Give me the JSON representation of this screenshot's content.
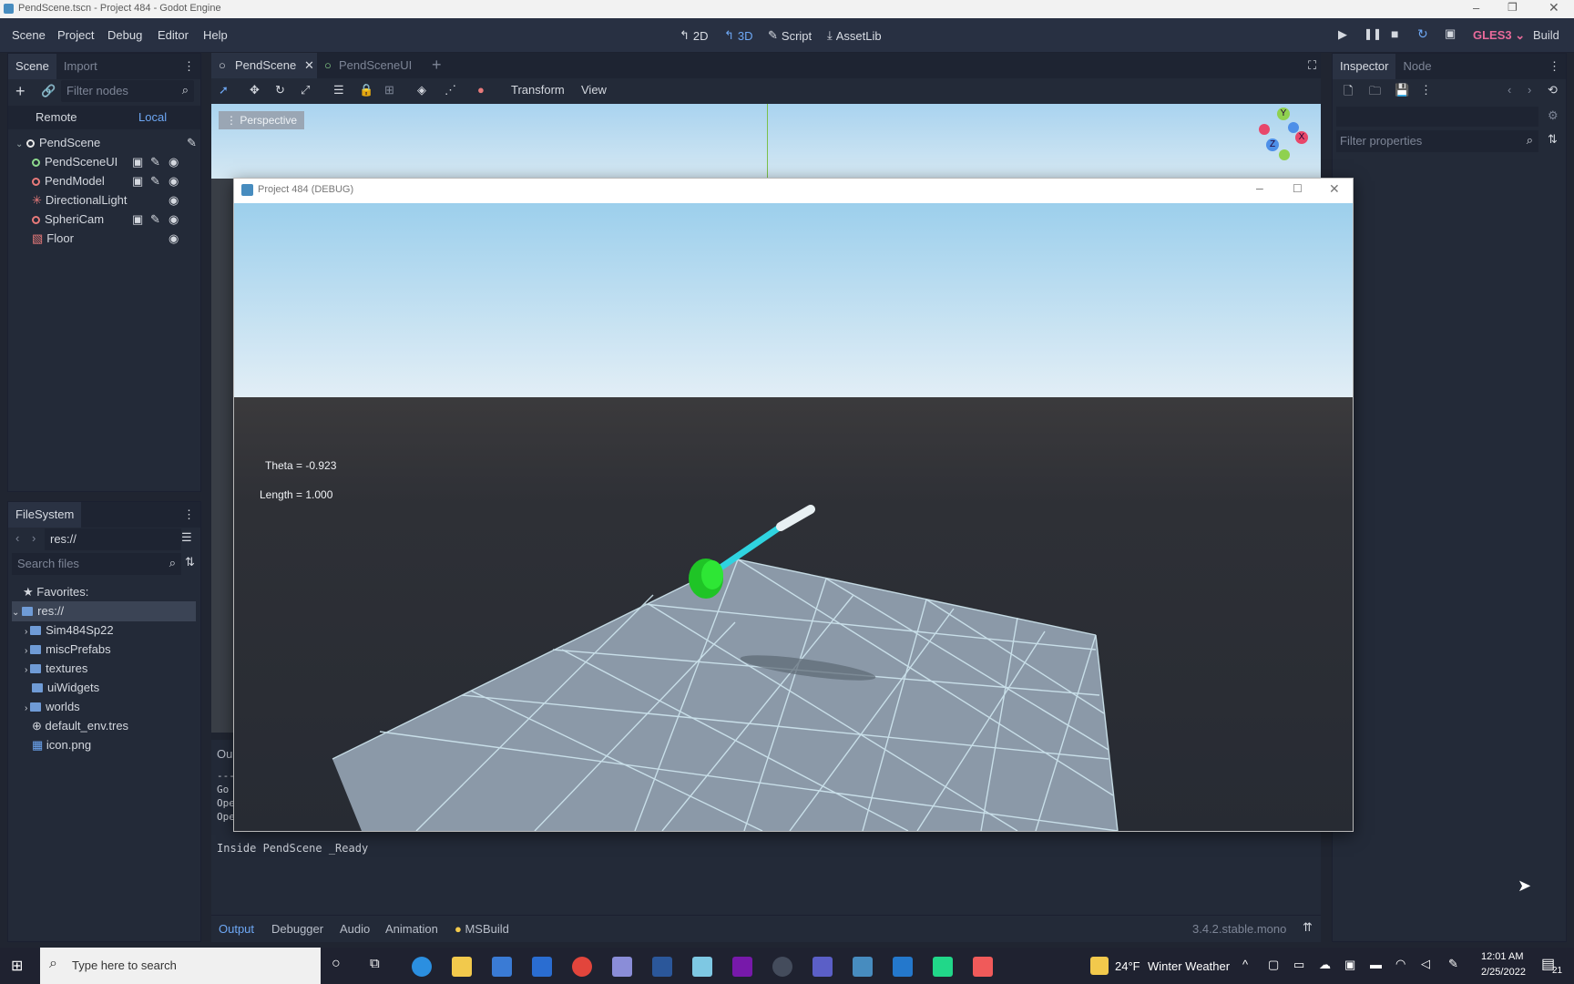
{
  "window": {
    "title": "PendScene.tscn - Project 484 - Godot Engine"
  },
  "menu": [
    "Scene",
    "Project",
    "Debug",
    "Editor",
    "Help"
  ],
  "workspaces": {
    "w2d": "2D",
    "w3d": "3D",
    "script": "Script",
    "assetlib": "AssetLib"
  },
  "renderer": "GLES3",
  "build_label": "Build",
  "scene_panel": {
    "tab_scene": "Scene",
    "tab_import": "Import",
    "filter_placeholder": "Filter nodes",
    "remote": "Remote",
    "local": "Local",
    "nodes": [
      {
        "name": "PendScene",
        "icon": "node3d-icon"
      },
      {
        "name": "PendSceneUI",
        "icon": "control-icon"
      },
      {
        "name": "PendModel",
        "icon": "spatial-icon"
      },
      {
        "name": "DirectionalLight",
        "icon": "light-icon"
      },
      {
        "name": "SpheriCam",
        "icon": "spatial-icon"
      },
      {
        "name": "Floor",
        "icon": "mesh-icon"
      }
    ]
  },
  "filesystem": {
    "title": "FileSystem",
    "path": "res://",
    "search_placeholder": "Search files",
    "favorites": "Favorites:",
    "root": "res://",
    "items": [
      "Sim484Sp22",
      "miscPrefabs",
      "textures",
      "uiWidgets",
      "worlds",
      "default_env.tres",
      "icon.png"
    ]
  },
  "editor_tabs": [
    "PendScene",
    "PendSceneUI"
  ],
  "toolbar": {
    "transform": "Transform",
    "view": "View"
  },
  "viewport": {
    "perspective": "Perspective",
    "gizmo_y": "Y",
    "gizmo_x": "X",
    "gizmo_z": "Z"
  },
  "debug_window": {
    "title": "Project 484 (DEBUG)",
    "theta": "Theta = -0.923",
    "length": "Length = 1.000"
  },
  "output": {
    "tab_partial": "Ou",
    "lines": [
      "---",
      "Go",
      "Ope",
      "Ope"
    ],
    "ready_line": "Inside PendScene _Ready"
  },
  "bottom_tabs": [
    "Output",
    "Debugger",
    "Audio",
    "Animation",
    "MSBuild"
  ],
  "version": "3.4.2.stable.mono",
  "inspector": {
    "tab_inspector": "Inspector",
    "tab_node": "Node",
    "filter_placeholder": "Filter properties"
  },
  "taskbar": {
    "search_placeholder": "Type here to search",
    "weather_temp": "24°F",
    "weather_text": "Winter Weather",
    "time": "12:01 AM",
    "date": "2/25/2022",
    "notification_count": "21"
  },
  "colors": {
    "accent": "#6ea8f5",
    "bg_dark": "#202531",
    "panel": "#232a38",
    "renderer": "#e86a9a",
    "floor": "#8b99a8",
    "pend_green": "#23d02a",
    "rod_cyan": "#2fd4e0"
  }
}
